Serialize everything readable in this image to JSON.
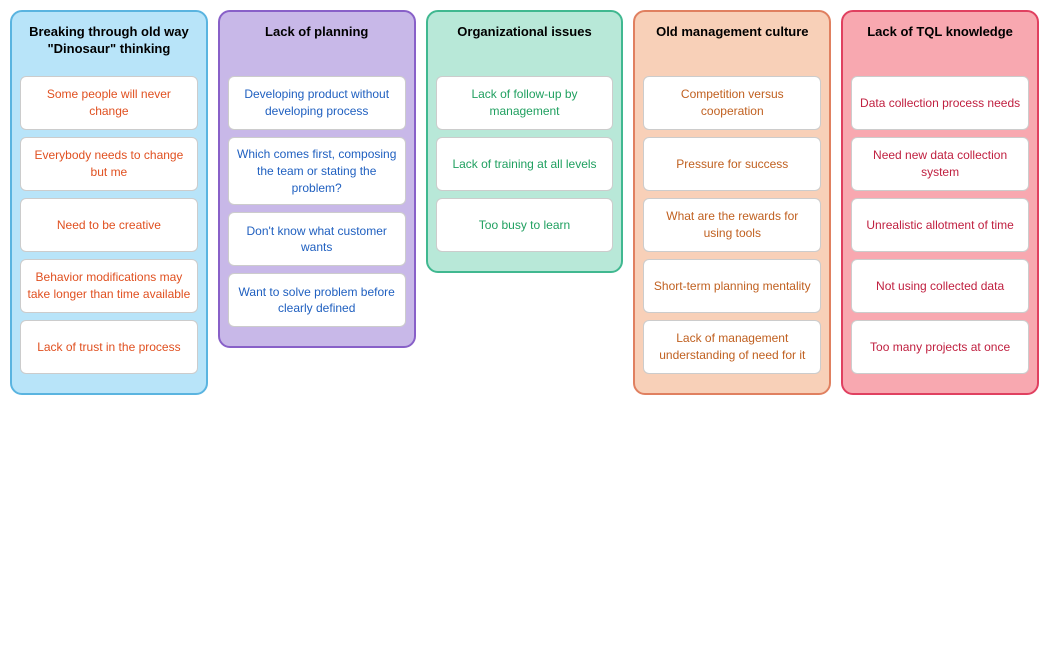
{
  "columns": [
    {
      "id": "col-1",
      "header": "Breaking through old way \"Dinosaur\" thinking",
      "colorClass": "col-1",
      "cards": [
        "Some people will never change",
        "Everybody needs to change but me",
        "Need to be creative",
        "Behavior modifications may take longer than time available",
        "Lack of trust in the process"
      ]
    },
    {
      "id": "col-2",
      "header": "Lack of planning",
      "colorClass": "col-2",
      "cards": [
        "Developing product without developing process",
        "Which comes first, composing the team or stating the problem?",
        "Don't know what customer wants",
        "Want to solve problem before clearly defined"
      ]
    },
    {
      "id": "col-3",
      "header": "Organizational issues",
      "colorClass": "col-3",
      "cards": [
        "Lack of follow-up by management",
        "Lack of training at all levels",
        "Too busy to learn"
      ]
    },
    {
      "id": "col-4",
      "header": "Old management culture",
      "colorClass": "col-4",
      "cards": [
        "Competition versus cooperation",
        "Pressure for success",
        "What are the rewards for using tools",
        "Short-term planning mentality",
        "Lack of management understanding of need for it"
      ]
    },
    {
      "id": "col-5",
      "header": "Lack of TQL knowledge",
      "colorClass": "col-5",
      "cards": [
        "Data collection process needs",
        "Need new data collection system",
        "Unrealistic allotment of time",
        "Not using collected data",
        "Too many projects at once"
      ]
    }
  ]
}
